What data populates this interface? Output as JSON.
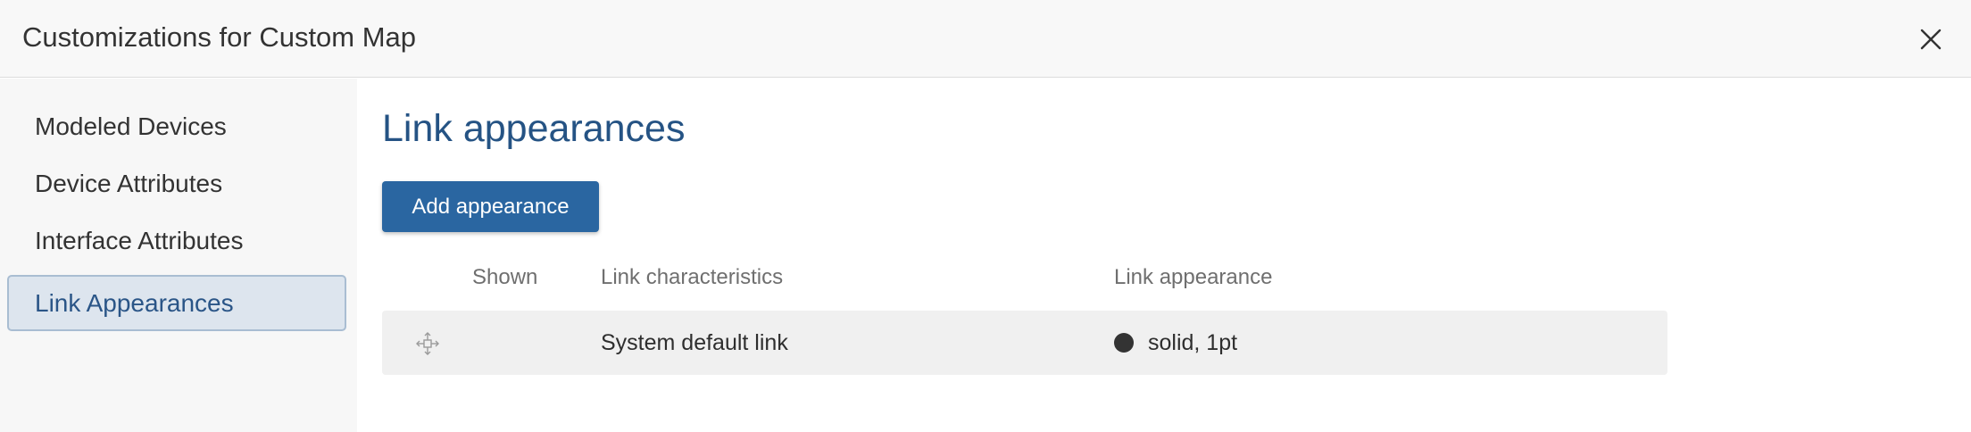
{
  "dialog": {
    "title": "Customizations for Custom Map",
    "close_icon": "close-icon"
  },
  "sidebar": {
    "items": [
      {
        "label": "Modeled Devices",
        "active": false
      },
      {
        "label": "Device Attributes",
        "active": false
      },
      {
        "label": "Interface Attributes",
        "active": false
      },
      {
        "label": "Link Appearances",
        "active": true
      }
    ]
  },
  "main": {
    "title": "Link appearances",
    "add_button_label": "Add appearance",
    "table": {
      "columns": [
        "Shown",
        "Link characteristics",
        "Link appearance"
      ],
      "rows": [
        {
          "handle_icon": "drag-handle-icon",
          "characteristics": "System default link",
          "appearance": "solid, 1pt",
          "swatch_color": "#333333"
        }
      ]
    }
  },
  "colors": {
    "accent": "#2a66a1",
    "title": "#255384",
    "active_item_bg": "#dde5ee"
  }
}
